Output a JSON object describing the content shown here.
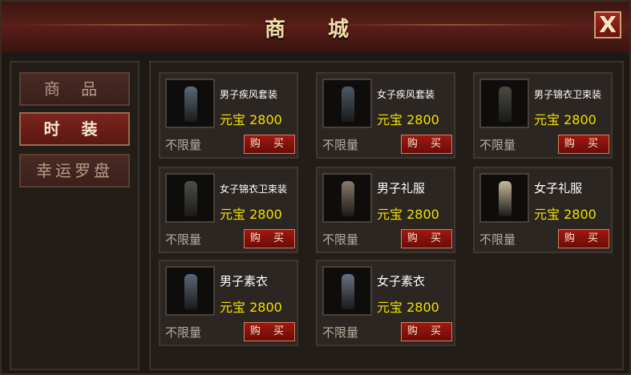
{
  "title": "商 城",
  "close_label": "X",
  "sidebar": {
    "items": [
      {
        "label": "商 品",
        "active": false
      },
      {
        "label": "时 装",
        "active": true
      },
      {
        "label": "幸运罗盘",
        "active": false
      }
    ]
  },
  "items": [
    {
      "name": "男子疾风套装",
      "price": "元宝 2800",
      "limit": "不限量",
      "buy": "购 买",
      "color": "#5a6a78"
    },
    {
      "name": "女子疾风套装",
      "price": "元宝 2800",
      "limit": "不限量",
      "buy": "购 买",
      "color": "#4a5a68"
    },
    {
      "name": "男子锦衣卫束装",
      "price": "元宝 2800",
      "limit": "不限量",
      "buy": "购 买",
      "color": "#4a4a40"
    },
    {
      "name": "女子锦衣卫束装",
      "price": "元宝 2800",
      "limit": "不限量",
      "buy": "购 买",
      "color": "#4a5048"
    },
    {
      "name": "男子礼服",
      "price": "元宝 2800",
      "limit": "不限量",
      "buy": "购 买",
      "color": "#8a7a68"
    },
    {
      "name": "女子礼服",
      "price": "元宝 2800",
      "limit": "不限量",
      "buy": "购 买",
      "color": "#c8b89a"
    },
    {
      "name": "男子素衣",
      "price": "元宝 2800",
      "limit": "不限量",
      "buy": "购 买",
      "color": "#5a6878"
    },
    {
      "name": "女子素衣",
      "price": "元宝 2800",
      "limit": "不限量",
      "buy": "购 买",
      "color": "#6a7080"
    }
  ]
}
